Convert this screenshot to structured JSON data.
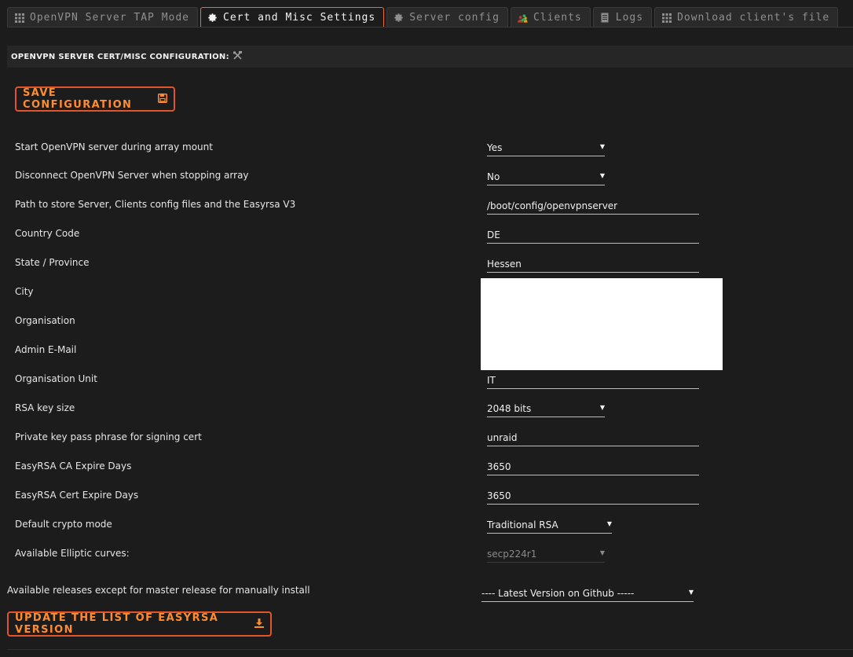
{
  "tabs": [
    {
      "label": "OpenVPN Server TAP Mode",
      "icon": "grid-icon",
      "active": false
    },
    {
      "label": "Cert and Misc Settings",
      "icon": "gear-icon",
      "active": true
    },
    {
      "label": "Server config",
      "icon": "gear-icon",
      "active": false
    },
    {
      "label": "Clients",
      "icon": "users-icon",
      "active": false
    },
    {
      "label": "Logs",
      "icon": "document-icon",
      "active": false
    },
    {
      "label": "Download client's file",
      "icon": "grid-icon",
      "active": false
    }
  ],
  "section": {
    "title": "OPENVPN SERVER CERT/MISC CONFIGURATION:",
    "icon": "tools-icon"
  },
  "buttons": {
    "save": "SAVE CONFIGURATION",
    "save_icon": "floppy-disk-icon",
    "update": "UPDATE THE LIST OF EASYRSA VERSION",
    "update_icon": "download-icon"
  },
  "rows": [
    {
      "label": "Start OpenVPN server during array mount",
      "value": "Yes",
      "type": "select"
    },
    {
      "label": "Disconnect OpenVPN Server when stopping array",
      "value": "No",
      "type": "select"
    },
    {
      "label": "Path to store Server, Clients config files and the Easyrsa V3",
      "value": "/boot/config/openvpnserver",
      "type": "text"
    },
    {
      "label": "Country Code",
      "value": "DE",
      "type": "text"
    },
    {
      "label": "State / Province",
      "value": "Hessen",
      "type": "text"
    },
    {
      "label": "City",
      "value": "",
      "type": "redacted"
    },
    {
      "label": "Organisation",
      "value": "",
      "type": "redacted"
    },
    {
      "label": "Admin E-Mail",
      "value": "",
      "type": "redacted"
    },
    {
      "label": "Organisation Unit",
      "value": "IT",
      "type": "text"
    },
    {
      "label": "RSA key size",
      "value": "2048 bits",
      "type": "select"
    },
    {
      "label": "Private key pass phrase for signing cert",
      "value": "unraid",
      "type": "text"
    },
    {
      "label": "EasyRSA CA Expire Days",
      "value": "3650",
      "type": "text"
    },
    {
      "label": "EasyRSA Cert Expire Days",
      "value": "3650",
      "type": "text"
    },
    {
      "label": "Default crypto mode",
      "value": "Traditional RSA",
      "type": "select"
    },
    {
      "label": "Available Elliptic curves:",
      "value": "secp224r1",
      "type": "select-disabled"
    }
  ],
  "releases": {
    "label": "Available releases except for master release for manually install",
    "value": "---- Latest Version on Github -----"
  },
  "colors": {
    "accent": "#f06b2c",
    "button_text": "#ff8c2f",
    "background": "#1c1c1c"
  }
}
